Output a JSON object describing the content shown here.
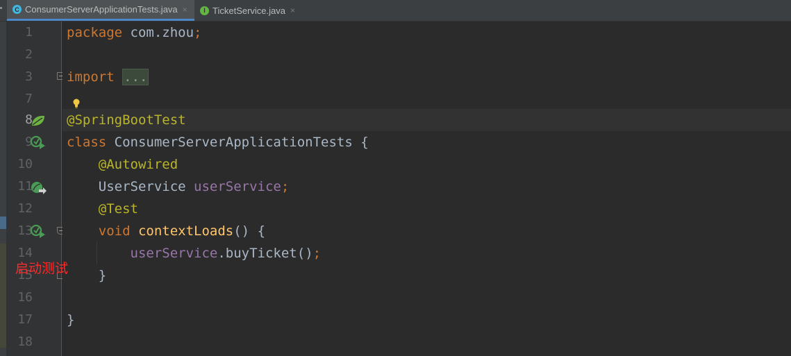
{
  "tabs": [
    {
      "name": "ConsumerServerApplicationTests.java",
      "icon": "class-test-icon",
      "icon_letter": "C",
      "active": true,
      "close": "×"
    },
    {
      "name": "TicketService.java",
      "icon": "interface-icon",
      "icon_letter": "I",
      "active": false,
      "close": "×"
    }
  ],
  "editor": {
    "line_numbers": [
      "1",
      "2",
      "3",
      "7",
      "8",
      "9",
      "10",
      "11",
      "12",
      "13",
      "14",
      "15",
      "16",
      "17",
      "18"
    ],
    "lines": [
      {
        "n": "1",
        "tokens": [
          [
            "kw",
            "package "
          ],
          [
            "",
            "com.zhou"
          ],
          [
            "kw",
            ";"
          ]
        ]
      },
      {
        "n": "2",
        "tokens": []
      },
      {
        "n": "3",
        "tokens": [
          [
            "kw",
            "import "
          ],
          [
            "dots",
            "..."
          ]
        ]
      },
      {
        "n": "7",
        "tokens": []
      },
      {
        "n": "8",
        "tokens": [
          [
            "ann",
            "@SpringBootTest"
          ]
        ]
      },
      {
        "n": "9",
        "tokens": [
          [
            "kw",
            "class "
          ],
          [
            "",
            "ConsumerServerApplicationTests {"
          ]
        ]
      },
      {
        "n": "10",
        "tokens": [
          [
            "",
            "    "
          ],
          [
            "ann",
            "@Autowired"
          ]
        ]
      },
      {
        "n": "11",
        "tokens": [
          [
            "",
            "    UserService "
          ],
          [
            "fld",
            "userService"
          ],
          [
            "kw",
            ";"
          ]
        ]
      },
      {
        "n": "12",
        "tokens": [
          [
            "",
            "    "
          ],
          [
            "ann",
            "@Test"
          ]
        ]
      },
      {
        "n": "13",
        "tokens": [
          [
            "",
            "    "
          ],
          [
            "kw",
            "void "
          ],
          [
            "mth",
            "contextLoads"
          ],
          [
            "",
            "() {"
          ]
        ]
      },
      {
        "n": "14",
        "tokens": [
          [
            "",
            "        "
          ],
          [
            "fld",
            "userService"
          ],
          [
            "",
            ".buyTicket()"
          ],
          [
            "kw",
            ";"
          ]
        ]
      },
      {
        "n": "15",
        "tokens": [
          [
            "",
            "    }"
          ]
        ]
      },
      {
        "n": "16",
        "tokens": []
      },
      {
        "n": "17",
        "tokens": [
          [
            "",
            "}"
          ]
        ]
      },
      {
        "n": "18",
        "tokens": []
      }
    ],
    "current_line": "8"
  },
  "annotation": "启动测试",
  "colors": {
    "keyword": "#cc7832",
    "annotation": "#bbb529",
    "field": "#9876aa",
    "method": "#ffc66d",
    "text": "#a9b7c6",
    "run_icon": "#499c54",
    "annotation_text": "#ff2a2a"
  }
}
